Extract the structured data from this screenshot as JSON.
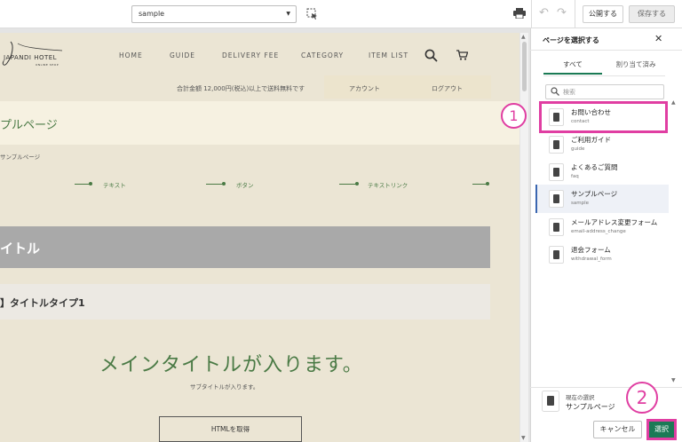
{
  "toolbar": {
    "page_select_value": "sample",
    "publish_label": "公開する",
    "save_label": "保存する"
  },
  "site": {
    "logo_text": "JAPANDI HOTEL",
    "logo_sub": "ONLINE SHOP",
    "nav": [
      "HOME",
      "GUIDE",
      "DELIVERY FEE",
      "CATEGORY",
      "ITEM LIST"
    ],
    "free_shipping": "合計金額 12,000円(税込)以上で送料無料です",
    "account": "アカウント",
    "logout": "ログアウト",
    "page_title": "プルページ",
    "breadcrumb": "サンプルページ",
    "anchors": [
      "テキスト",
      "ボタン",
      "テキストリンク"
    ],
    "title_band": "イトル",
    "title_type": "】タイトルタイプ1",
    "main_title": "メインタイトルが入ります。",
    "sub_title": "サブタイトルが入ります。",
    "html_button": "HTMLを取得"
  },
  "panel": {
    "title": "ページを選択する",
    "tabs": [
      "すべて",
      "割り当て済み"
    ],
    "search_placeholder": "検索",
    "items": [
      {
        "name": "お問い合わせ",
        "slug": "contact"
      },
      {
        "name": "ご利用ガイド",
        "slug": "guide"
      },
      {
        "name": "よくあるご質問",
        "slug": "faq"
      },
      {
        "name": "サンプルページ",
        "slug": "sample"
      },
      {
        "name": "メールアドレス変更フォーム",
        "slug": "email-address_change"
      },
      {
        "name": "退会フォーム",
        "slug": "withdrawal_form"
      }
    ],
    "current_label": "現在の選択",
    "current_value": "サンプルページ",
    "cancel_label": "キャンセル",
    "select_label": "選択"
  },
  "callouts": {
    "first": "1",
    "second": "2"
  },
  "colors": {
    "accent": "#1b7a56",
    "highlight": "#e03ea2",
    "site_green": "#4a7a45",
    "site_bg": "#ebe5d4"
  }
}
